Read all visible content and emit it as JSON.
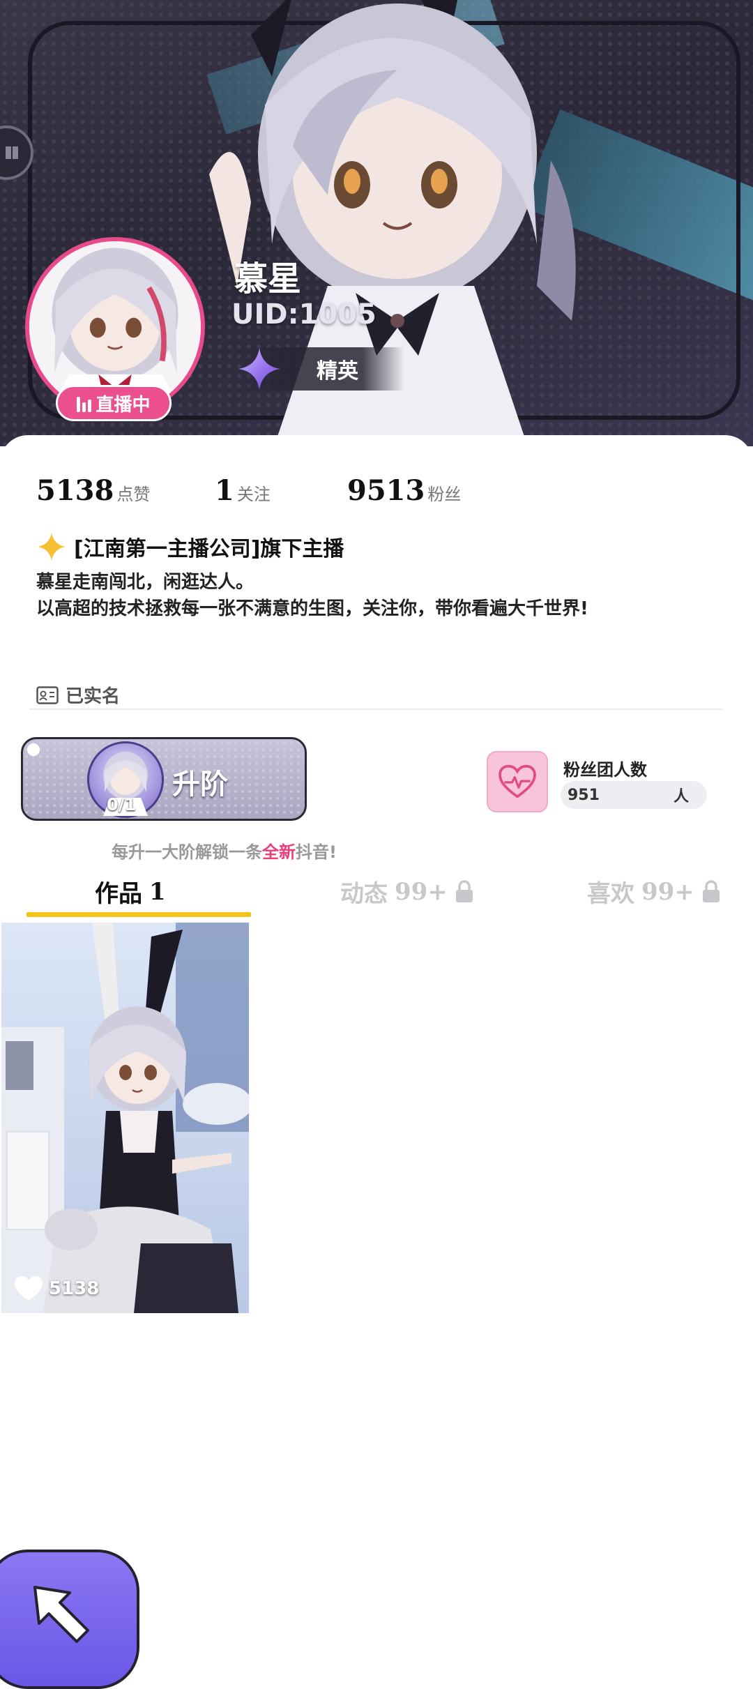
{
  "profile": {
    "name": "慕星",
    "uid": "UID:1005",
    "rank": "精英",
    "live_status": "直播中"
  },
  "stats": [
    {
      "value": "5138",
      "label": "点赞"
    },
    {
      "value": "1",
      "label": "关注"
    },
    {
      "value": "9513",
      "label": "粉丝"
    }
  ],
  "company": "[江南第一主播公司]旗下主播",
  "bio": {
    "line1": "慕星走南闯北，闲逛达人。",
    "line2": "以高超的技术拯救每一张不满意的生图，关注你，带你看遍大千世界!"
  },
  "verified_label": "已实名",
  "levelup": {
    "label": "升阶",
    "progress_text": "0/1"
  },
  "fanclub": {
    "title": "粉丝团人数",
    "count": "951",
    "unit": "人"
  },
  "unlock_tip": {
    "prefix": "每升一大阶解锁一条",
    "highlight": "全新",
    "suffix": "抖音!"
  },
  "tabs": [
    {
      "label": "作品",
      "count": "1",
      "locked": false
    },
    {
      "label": "动态",
      "count": "99+",
      "locked": true
    },
    {
      "label": "喜欢",
      "count": "99+",
      "locked": true
    }
  ],
  "works": [
    {
      "likes": "5138"
    }
  ],
  "colors": {
    "accent_pink": "#ec4f8e",
    "tab_underline": "#f2c419",
    "highlight_red": "#ec3d7a",
    "fab_purple": "#7a66ec"
  }
}
